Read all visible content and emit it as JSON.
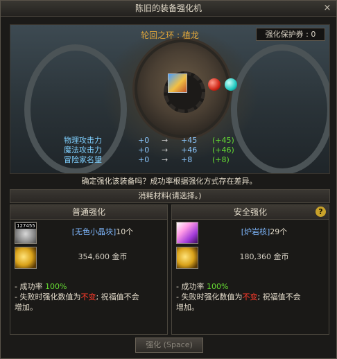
{
  "window": {
    "title": "陈旧的装备强化机",
    "close_symbol": "×"
  },
  "item": {
    "name": "轮回之环 : 植龙"
  },
  "protect_ticket": {
    "text": "强化保护券 : 0"
  },
  "stats": [
    {
      "name": "物理攻击力",
      "current": "+0",
      "arrow": "→",
      "new": "+45",
      "diff": "(+45)"
    },
    {
      "name": "魔法攻击力",
      "current": "+0",
      "arrow": "→",
      "new": "+46",
      "diff": "(+46)"
    },
    {
      "name": "冒险家名望",
      "current": "+0",
      "arrow": "→",
      "new": "+8",
      "diff": "(+8)"
    }
  ],
  "confirm_text": "确定强化该装备吗？成功率根据强化方式存在差异。",
  "materials_header": "消耗材料(请选择。)",
  "normal": {
    "title": "普通强化",
    "material_count_badge": "127455",
    "material_name": "[无色小晶块]",
    "material_qty": "10个",
    "gold_amount": "354,600",
    "gold_unit": "金币",
    "rule1_prefix": "- 成功率",
    "rule1_rate": "100%",
    "rule2_prefix": "- 失败时强化数值为",
    "rule2_keyword": "不变",
    "rule2_suffix": "; 祝福值不会",
    "rule2_line2": "增加。"
  },
  "safe": {
    "title": "安全强化",
    "help_symbol": "?",
    "material_name": "[炉岩核]",
    "material_qty": "29个",
    "gold_amount": "180,360",
    "gold_unit": "金币",
    "rule1_prefix": "- 成功率",
    "rule1_rate": "100%",
    "rule2_prefix": "- 失败时强化数值为",
    "rule2_keyword": "不变",
    "rule2_suffix": "; 祝福值不会",
    "rule2_line2": "增加。"
  },
  "enhance_button": "强化 (Space)",
  "colors": {
    "accent_gold": "#e0a63a",
    "stat_blue": "#7fd0ff",
    "diff_green": "#66dd33",
    "warn_red": "#ff3a2a"
  },
  "icons": {
    "item": "ring-item-icon",
    "orb_left": "red-orb-icon",
    "orb_right": "cyan-orb-icon",
    "normal_material": "crystal-chunk-icon",
    "safe_material": "pink-crystal-icon",
    "gold": "gold-coins-icon"
  }
}
